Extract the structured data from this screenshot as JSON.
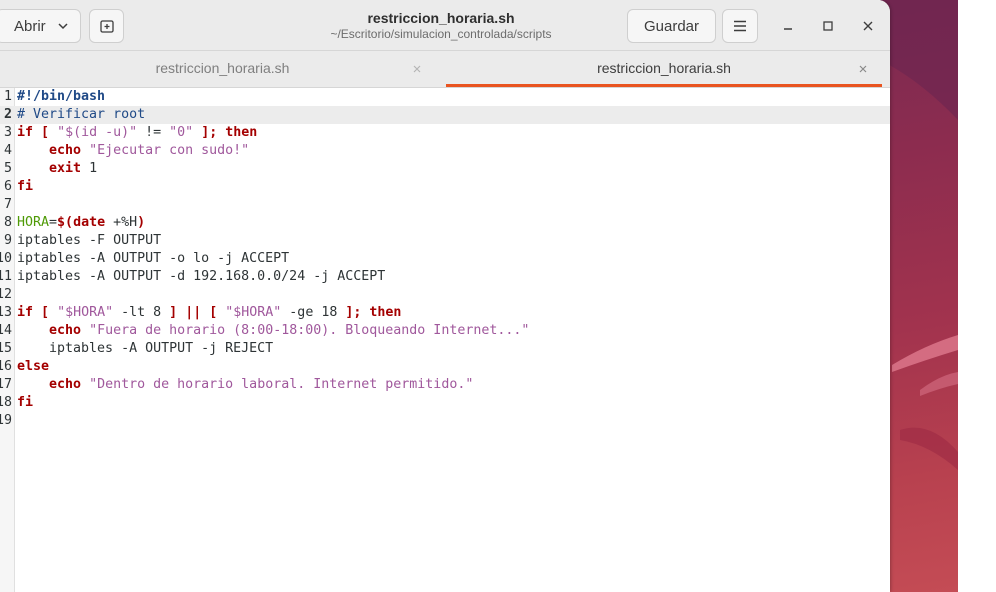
{
  "window": {
    "title": "restriccion_horaria.sh",
    "subtitle": "~/Escritorio/simulacion_controlada/scripts",
    "open_label": "Abrir",
    "save_label": "Guardar"
  },
  "tabs": [
    {
      "label": "restriccion_horaria.sh",
      "active": false
    },
    {
      "label": "restriccion_horaria.sh",
      "active": true
    }
  ],
  "colors": {
    "accent": "#e95420",
    "keyword": "#a40000",
    "string": "#a0589c",
    "variable": "#4e9a06",
    "comment": "#204a87"
  },
  "editor": {
    "current_line": 2,
    "lines": [
      {
        "n": "1",
        "code": "#!/bin/bash"
      },
      {
        "n": "2",
        "code": "# Verificar root"
      },
      {
        "n": "3",
        "code": "if [ \"$(id -u)\" != \"0\" ]; then"
      },
      {
        "n": "4",
        "code": "    echo \"Ejecutar con sudo!\""
      },
      {
        "n": "5",
        "code": "    exit 1"
      },
      {
        "n": "6",
        "code": "fi"
      },
      {
        "n": "7",
        "code": ""
      },
      {
        "n": "8",
        "code": "HORA=$(date +%H)"
      },
      {
        "n": "9",
        "code": "iptables -F OUTPUT"
      },
      {
        "n": "10",
        "code": "iptables -A OUTPUT -o lo -j ACCEPT"
      },
      {
        "n": "11",
        "code": "iptables -A OUTPUT -d 192.168.0.0/24 -j ACCEPT"
      },
      {
        "n": "12",
        "code": ""
      },
      {
        "n": "13",
        "code": "if [ \"$HORA\" -lt 8 ] || [ \"$HORA\" -ge 18 ]; then"
      },
      {
        "n": "14",
        "code": "    echo \"Fuera de horario (8:00-18:00). Bloqueando Internet...\""
      },
      {
        "n": "15",
        "code": "    iptables -A OUTPUT -j REJECT"
      },
      {
        "n": "16",
        "code": "else"
      },
      {
        "n": "17",
        "code": "    echo \"Dentro de horario laboral. Internet permitido.\""
      },
      {
        "n": "18",
        "code": "fi"
      },
      {
        "n": "19",
        "code": ""
      }
    ]
  }
}
